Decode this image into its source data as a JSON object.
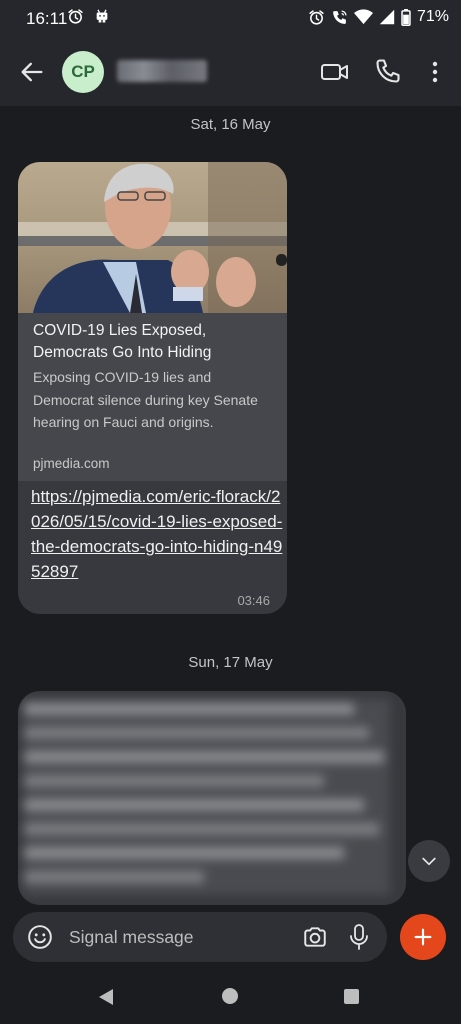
{
  "status_bar": {
    "time": "16:11",
    "battery": "71%",
    "left_icons": [
      "alarm-icon",
      "android-notification-icon"
    ],
    "right_icons": [
      "alarm-icon",
      "wifi-calling-icon",
      "wifi-icon",
      "signal-icon",
      "battery-icon"
    ]
  },
  "header": {
    "avatar_initials": "CP",
    "avatar_bg": "#c9eecb",
    "contact_name_redacted": true,
    "icons": [
      "back-arrow-icon",
      "video-call-icon",
      "phone-icon",
      "more-vert-icon"
    ]
  },
  "conversation": {
    "date_1": "Sat, 16 May",
    "date_2": "Sun, 17 May",
    "message_1": {
      "link_preview": {
        "title": "COVID-19 Lies Exposed, Democrats Go Into Hiding",
        "description": "Exposing COVID-19 lies and Democrat silence during key Senate hearing on Fauci and origins.",
        "domain": "pjmedia.com"
      },
      "link": "https://pjmedia.com/eric-florack/2026/05/15/covid-19-lies-exposed-the-democrats-go-into-hiding-n4952897",
      "time": "03:46"
    },
    "message_2": {
      "content_redacted": true
    }
  },
  "composer": {
    "placeholder": "Signal message",
    "icons": [
      "emoji-icon",
      "camera-icon",
      "mic-icon",
      "plus-icon"
    ],
    "accent": "#e5471c"
  },
  "nav_bar": {
    "icons": [
      "nav-back-icon",
      "nav-home-icon",
      "nav-recents-icon"
    ]
  }
}
